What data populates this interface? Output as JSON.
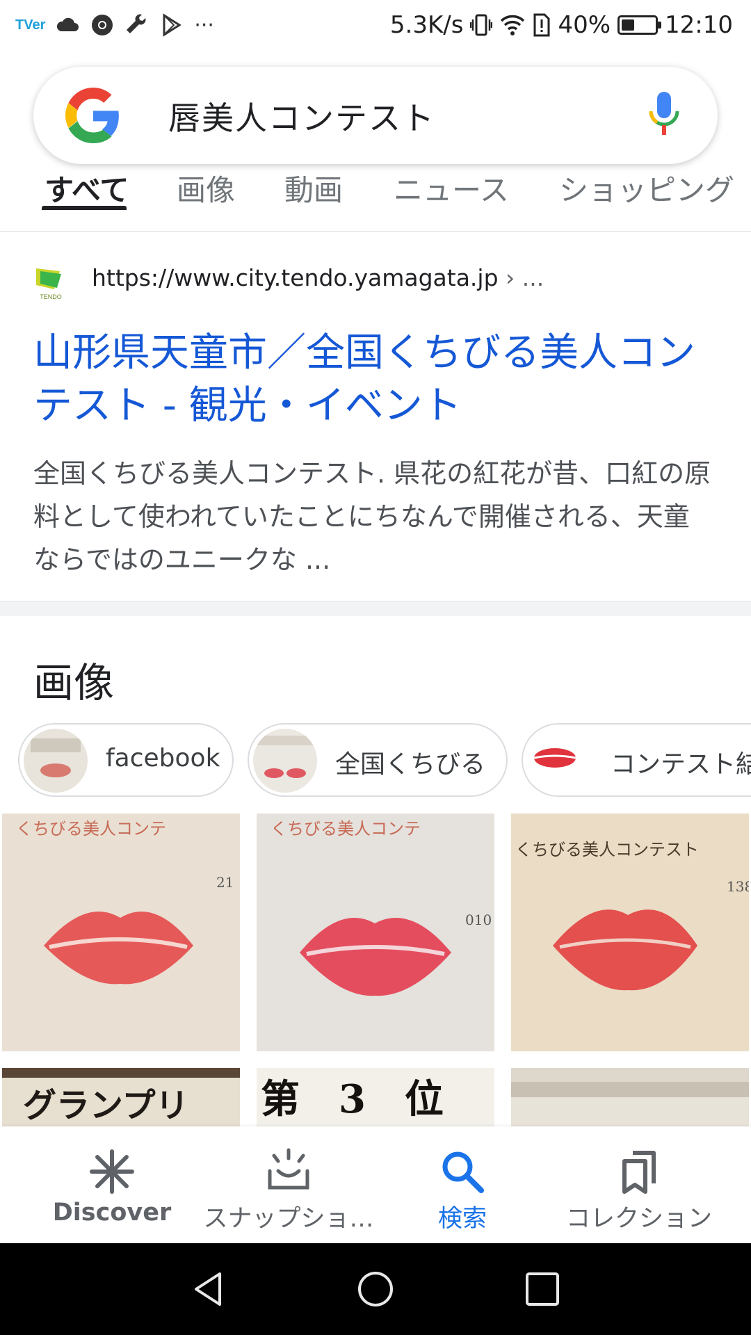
{
  "status_bar": {
    "app_mark": "TVer",
    "network_speed": "5.3K/s",
    "battery": "40%",
    "battery_level": 0.4,
    "time": "12:10",
    "overflow": "···"
  },
  "search": {
    "query": "唇美人コンテスト"
  },
  "tabs": [
    "すべて",
    "画像",
    "動画",
    "ニュース",
    "ショッピング"
  ],
  "active_tab_index": 0,
  "result": {
    "url": "https://www.city.tendo.yamagata.jp",
    "crumb": " › ...",
    "favicon_label": "TENDO",
    "title": "山形県天童市／全国くちびる美人コンテスト - 観光・イベント",
    "snippet": "全国くちびる美人コンテスト. 県花の紅花が昔、口紅の原料として使われていたことにちなんで開催される、天童ならではのユニークな ..."
  },
  "images_section": {
    "heading": "画像",
    "chips": [
      {
        "label": "facebook"
      },
      {
        "label": "全国くちびる"
      },
      {
        "label": "コンテスト結"
      }
    ],
    "tile_texts": [
      "くちびる美人コンテ",
      "くちびる美人コンテ",
      "くちびる美人コンテスト",
      "グランプリ",
      "第　3　位",
      ""
    ],
    "tile_numbers": [
      "21",
      "010",
      "138"
    ]
  },
  "bottom_nav": [
    {
      "label": "Discover",
      "icon": "discover-icon"
    },
    {
      "label": "スナップショ…",
      "icon": "snapshot-icon"
    },
    {
      "label": "検索",
      "icon": "search-icon"
    },
    {
      "label": "コレクション",
      "icon": "collections-icon"
    }
  ],
  "colors": {
    "link": "#1558d6",
    "active_nav": "#1a73e8",
    "lip_red": "#e0474f"
  }
}
